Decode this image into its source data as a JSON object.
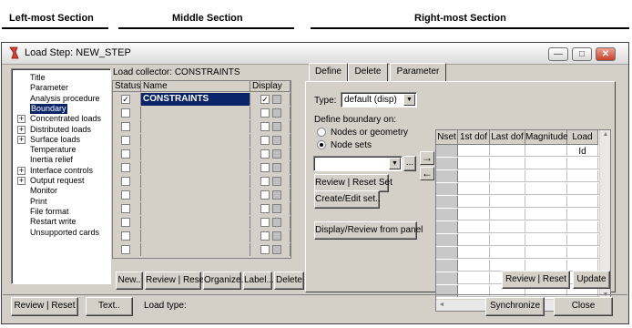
{
  "annotations": {
    "left": "Left-most Section",
    "middle": "Middle Section",
    "right": "Right-most Section"
  },
  "window": {
    "title": "Load Step: NEW_STEP",
    "minimize_glyph": "—",
    "maximize_glyph": "□",
    "close_glyph": "✕"
  },
  "tree": {
    "items": [
      {
        "label": "Title",
        "expandable": false
      },
      {
        "label": "Parameter",
        "expandable": false
      },
      {
        "label": "Analysis procedure",
        "expandable": false
      },
      {
        "label": "Boundary",
        "expandable": false,
        "selected": true
      },
      {
        "label": "Concentrated loads",
        "expandable": true
      },
      {
        "label": "Distributed loads",
        "expandable": true
      },
      {
        "label": "Surface loads",
        "expandable": true
      },
      {
        "label": "Temperature",
        "expandable": false
      },
      {
        "label": "Inertia relief",
        "expandable": false
      },
      {
        "label": "Interface controls",
        "expandable": true
      },
      {
        "label": "Output request",
        "expandable": true
      },
      {
        "label": "Monitor",
        "expandable": false
      },
      {
        "label": "Print",
        "expandable": false
      },
      {
        "label": "File format",
        "expandable": false
      },
      {
        "label": "Restart write",
        "expandable": false
      },
      {
        "label": "Unsupported cards",
        "expandable": false
      }
    ],
    "expander_glyph": "+"
  },
  "collector": {
    "label": "Load collector: CONSTRAINTS",
    "columns": [
      "Status",
      "Name",
      "Display"
    ],
    "rows": [
      {
        "status": true,
        "name": "CONSTRAINTS",
        "display": true
      },
      {
        "status": false,
        "name": "",
        "display": false
      },
      {
        "status": false,
        "name": "",
        "display": false
      },
      {
        "status": false,
        "name": "",
        "display": false
      },
      {
        "status": false,
        "name": "",
        "display": false
      },
      {
        "status": false,
        "name": "",
        "display": false
      },
      {
        "status": false,
        "name": "",
        "display": false
      },
      {
        "status": false,
        "name": "",
        "display": false
      },
      {
        "status": false,
        "name": "",
        "display": false
      },
      {
        "status": false,
        "name": "",
        "display": false
      },
      {
        "status": false,
        "name": "",
        "display": false
      },
      {
        "status": false,
        "name": "",
        "display": false
      }
    ],
    "check_glyph": "✓",
    "buttons": {
      "new": "New..",
      "review_reset": "Review | Reset",
      "organize": "Organize..",
      "label": "Label...",
      "delete": "Delete"
    }
  },
  "tabs": {
    "define": "Define",
    "delete": "Delete",
    "parameter": "Parameter"
  },
  "define": {
    "type_label": "Type:",
    "type_value": "default (disp)",
    "boundary_label": "Define boundary on:",
    "options": [
      "Nodes or geometry",
      "Node sets"
    ],
    "selected_option": 1,
    "set_value": "",
    "browse": "...",
    "review_reset_set": "Review | Reset Set",
    "create_edit_set": "Create/Edit set..",
    "display_review": "Display/Review from panel",
    "add_arrow": "→",
    "remove_arrow": "←"
  },
  "grid": {
    "columns": [
      "Nset",
      "1st dof",
      "Last dof",
      "Magnitude",
      "Load Id"
    ],
    "row_count": 12,
    "up": "▲",
    "down": "▼",
    "left": "◄",
    "right": "►"
  },
  "right_buttons": {
    "review_reset": "Review | Reset",
    "update": "Update"
  },
  "footer": {
    "review_reset": "Review | Reset",
    "text": "Text..",
    "load_type_label": "Load type:",
    "synchronize": "Synchronize",
    "close": "Close"
  }
}
